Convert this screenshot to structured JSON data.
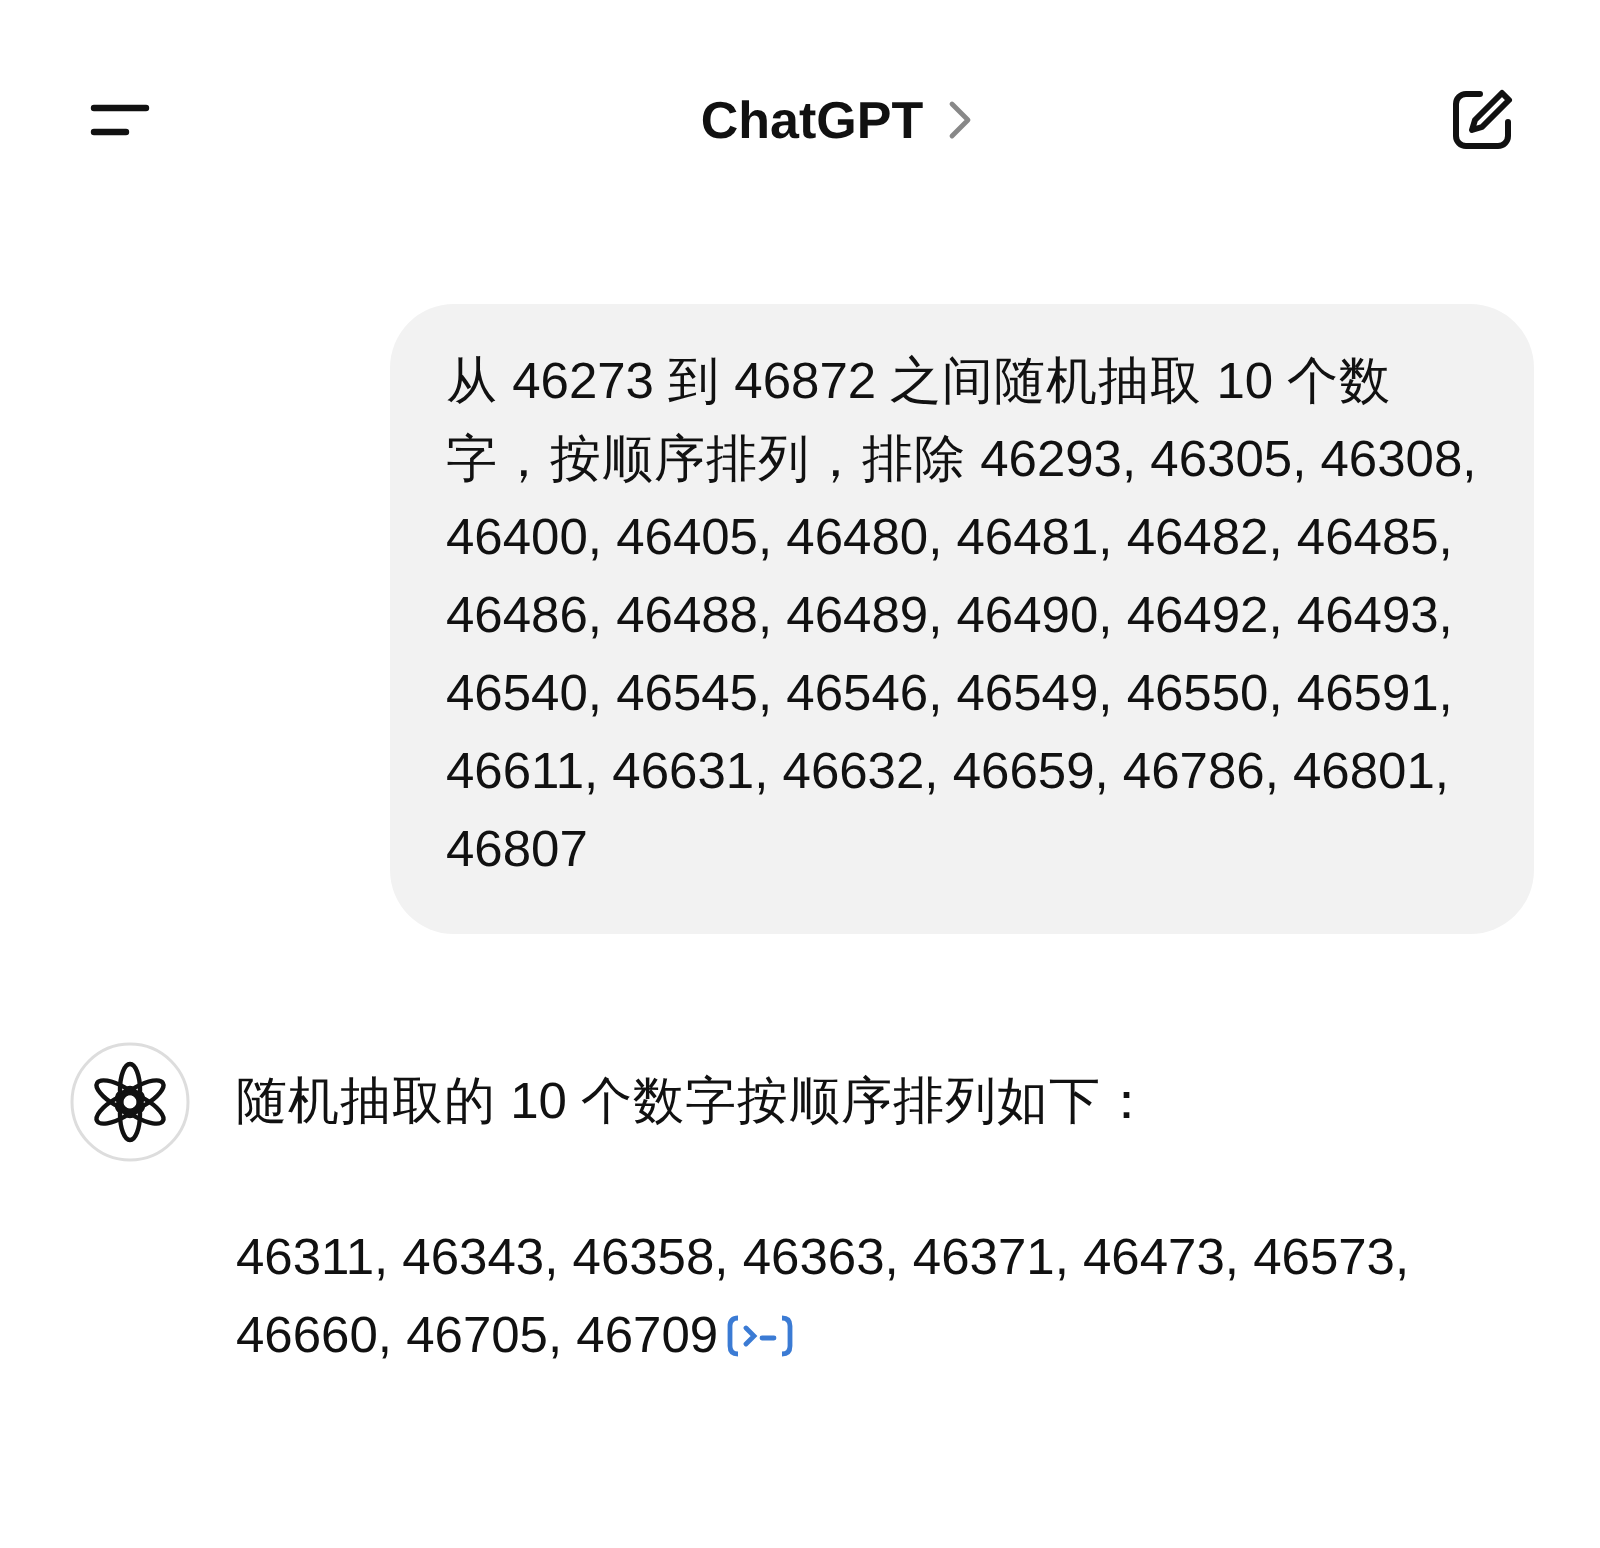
{
  "header": {
    "title": "ChatGPT"
  },
  "messages": [
    {
      "kind": "user",
      "paragraphs": [
        "从 46273 到 46872 之间随机抽取 10 个数字，按顺序排列，排除 46293, 46305, 46308, 46400, 46405, 46480, 46481, 46482, 46485, 46486, 46488, 46489, 46490, 46492, 46493, 46540, 46545, 46546, 46549, 46550, 46591, 46611, 46631, 46632, 46659, 46786, 46801, 46807"
      ]
    },
    {
      "kind": "assistant",
      "paragraphs": [
        "随机抽取的 10 个数字按顺序排列如下：",
        "46311, 46343, 46358, 46363, 46371, 46473, 46573, 46660, 46705, 46709"
      ]
    }
  ]
}
